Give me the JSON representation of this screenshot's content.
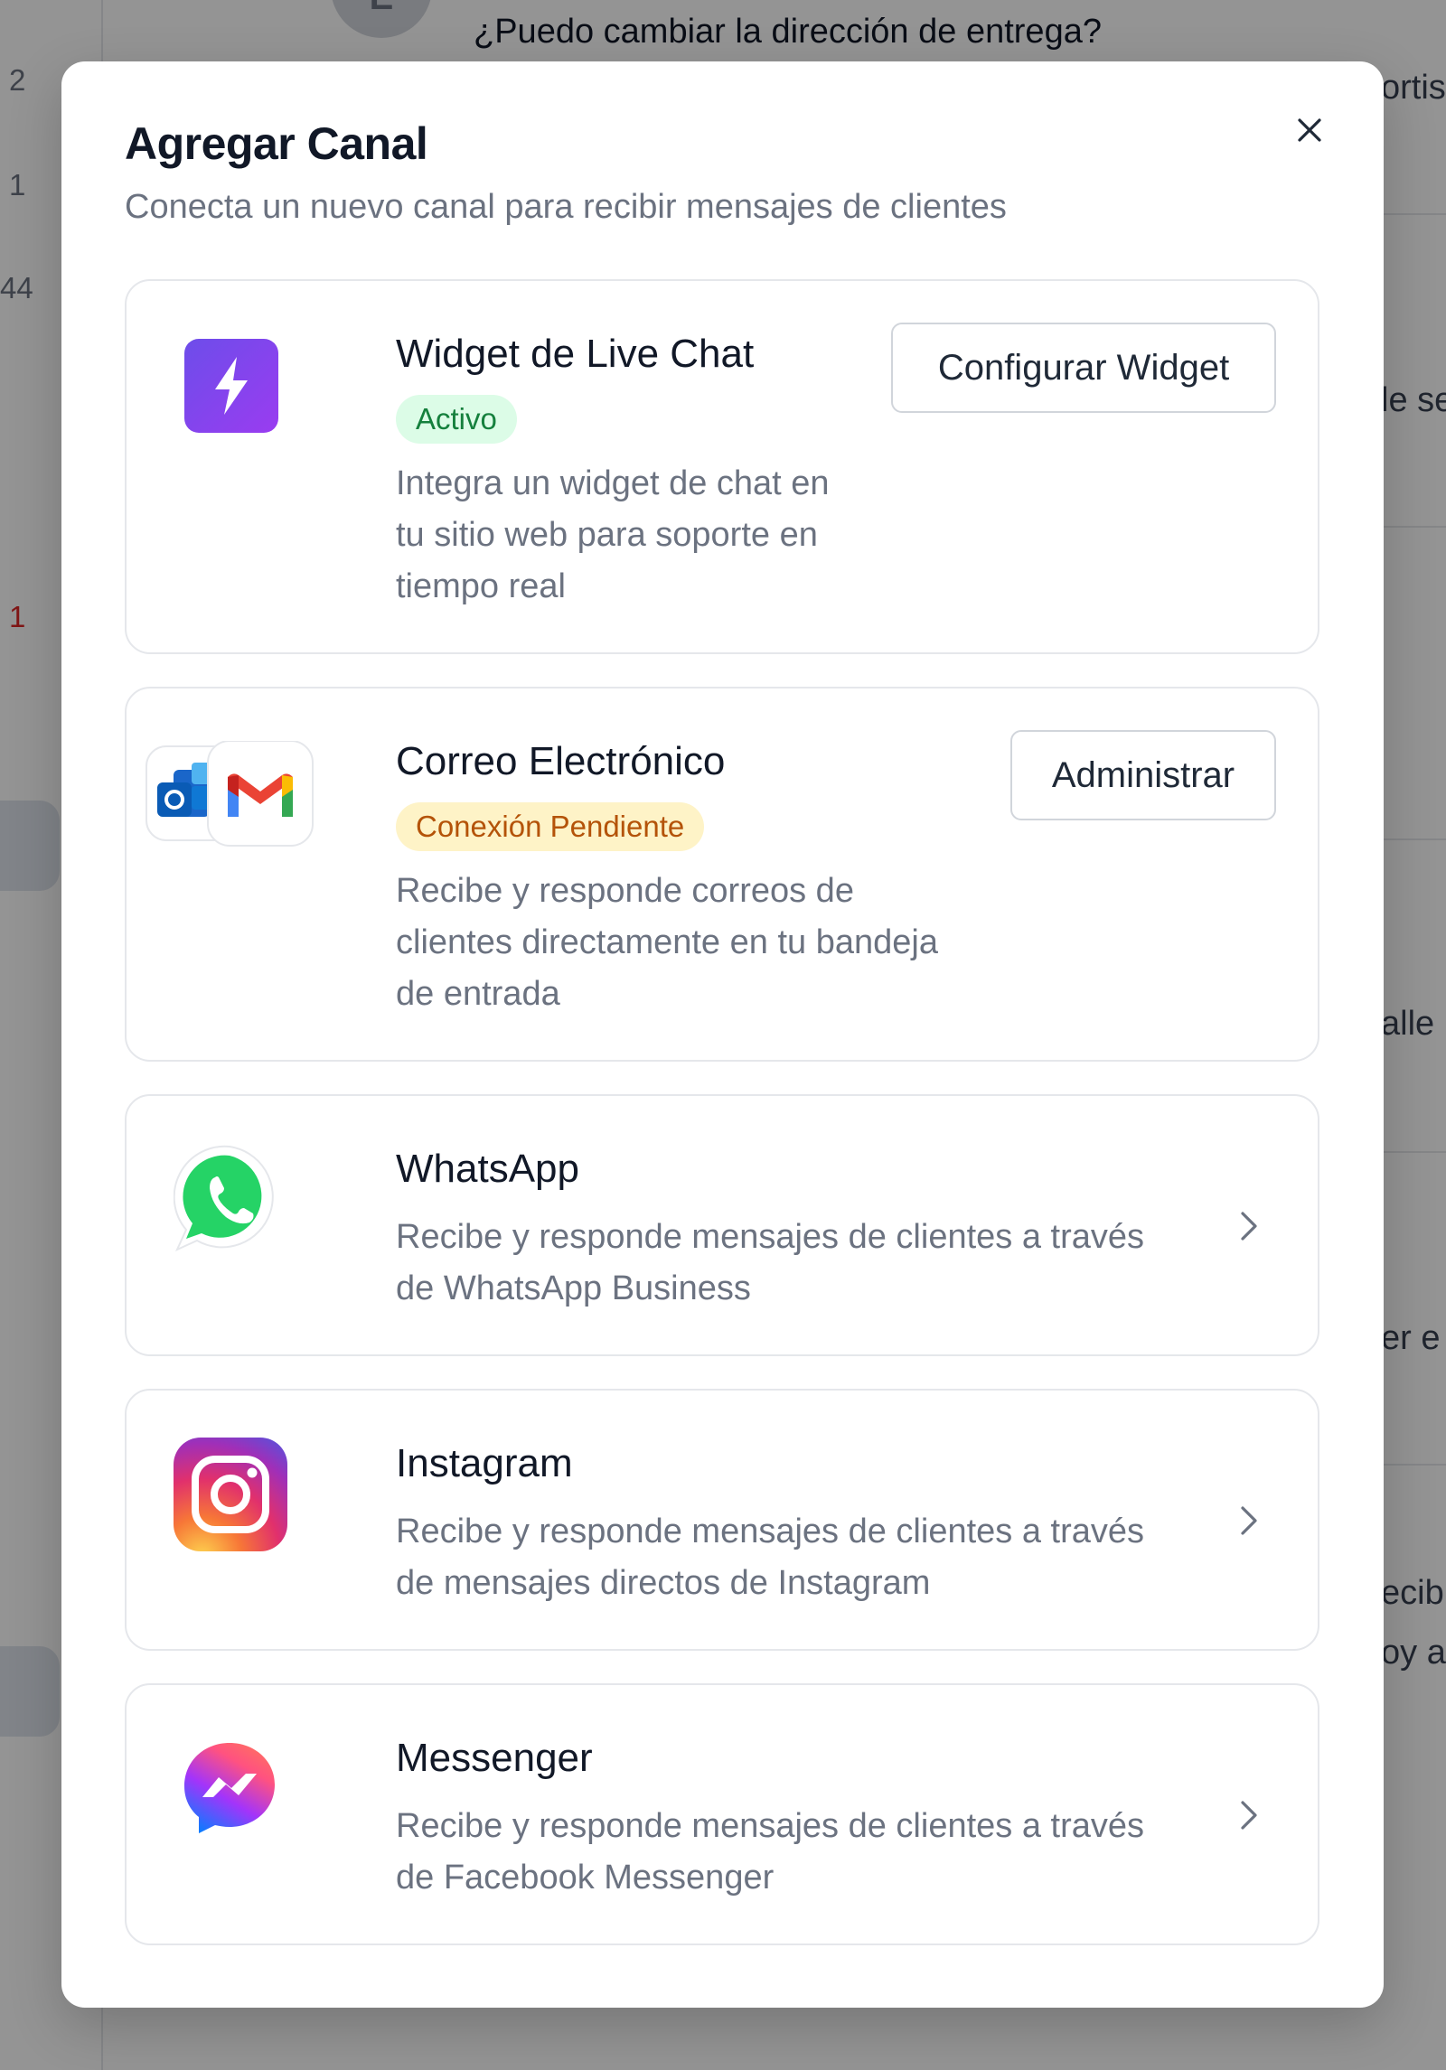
{
  "background": {
    "question": "¿Puedo cambiar la dirección de entrega?",
    "avatar_letter": "E",
    "sidebar_numbers": [
      "2",
      "1",
      "44",
      "1"
    ],
    "fragments": [
      "ortis",
      "le se",
      "alle",
      "er e",
      "ecibi",
      "oy ac"
    ]
  },
  "modal": {
    "title": "Agregar Canal",
    "subtitle": "Conecta un nuevo canal para recibir mensajes de clientes",
    "close_icon": "close-icon",
    "channels": [
      {
        "name": "Widget de Live Chat",
        "status": "Activo",
        "description_lines": [
          "Integra un widget de chat en",
          "tu sitio web para soporte en",
          "tiempo real"
        ],
        "action": "Configurar Widget",
        "icon": "lightning-icon"
      },
      {
        "name": "Correo Electrónico",
        "status": "Conexión Pendiente",
        "description_lines": [
          "Recibe y responde correos de",
          "clientes directamente en tu bandeja",
          "de entrada"
        ],
        "action": "Administrar",
        "icon": "gmail-outlook-icon"
      },
      {
        "name": "WhatsApp",
        "description_lines": [
          "Recibe y responde mensajes de clientes a través",
          "de WhatsApp Business"
        ],
        "icon": "whatsapp-icon"
      },
      {
        "name": "Instagram",
        "description_lines": [
          "Recibe y responde mensajes de clientes a través",
          "de mensajes directos de Instagram"
        ],
        "icon": "instagram-icon"
      },
      {
        "name": "Messenger",
        "description_lines": [
          "Recibe y responde mensajes de clientes a través",
          "de Facebook Messenger"
        ],
        "icon": "messenger-icon"
      }
    ]
  },
  "colors": {
    "active_badge_bg": "#dcfce7",
    "active_badge_text": "#15803d",
    "pending_badge_bg": "#fef3c7",
    "pending_badge_text": "#b45309",
    "live_chat_icon": "#7c3aed"
  }
}
